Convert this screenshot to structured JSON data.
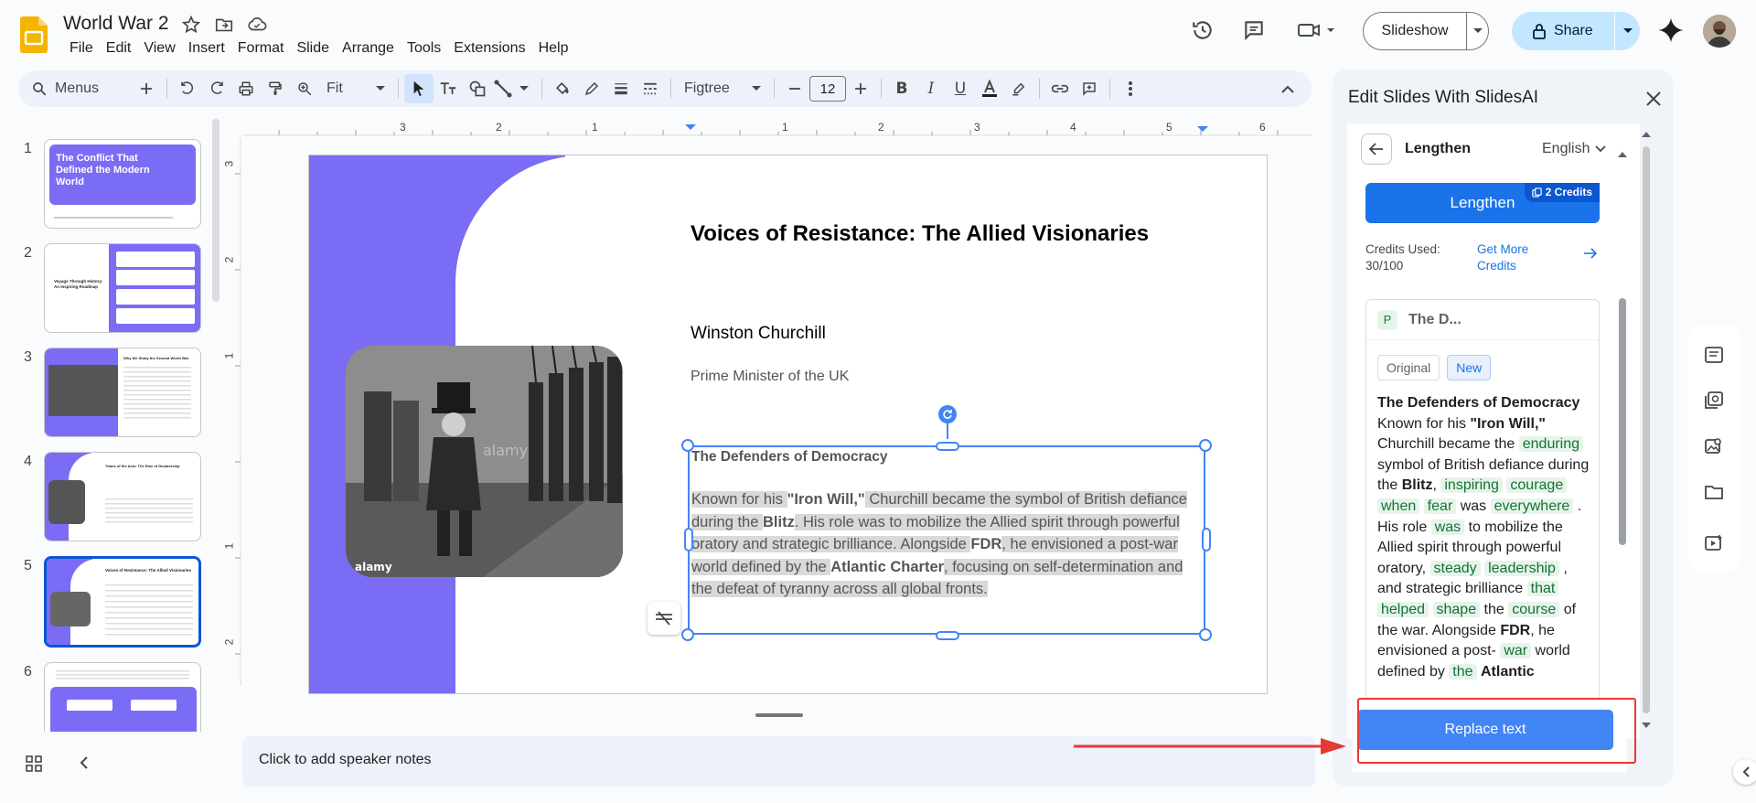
{
  "app": {
    "doc_title": "World War 2",
    "menus": [
      "File",
      "Edit",
      "View",
      "Insert",
      "Format",
      "Slide",
      "Arrange",
      "Tools",
      "Extensions",
      "Help"
    ]
  },
  "header": {
    "slideshow_label": "Slideshow",
    "share_label": "Share"
  },
  "toolbar": {
    "search_label": "Menus",
    "zoom": "Fit",
    "font": "Figtree",
    "font_size": "12"
  },
  "filmstrip": {
    "slides": [
      {
        "num": "1",
        "title": "The Conflict That Defined the Modern World"
      },
      {
        "num": "2",
        "title": "Voyage Through History: An Inspiring Roadmap"
      },
      {
        "num": "3",
        "title": "Why We Study the Second World War"
      },
      {
        "num": "4",
        "title": "Titans of the Axis: The Rise of Dictatorship"
      },
      {
        "num": "5",
        "title": "Voices of Resistance: The Allied Visionaries"
      },
      {
        "num": "6",
        "title": ""
      }
    ]
  },
  "ruler": {
    "h_labels": [
      "3",
      "2",
      "1",
      "1",
      "2",
      "3",
      "4",
      "5",
      "6"
    ],
    "v_labels": [
      "3",
      "2",
      "1",
      "1",
      "2"
    ]
  },
  "slide": {
    "title": "Voices of Resistance: The Allied Visionaries",
    "name": "Winston Churchill",
    "role": "Prime Minister of the UK",
    "text_heading": "The Defenders of Democracy",
    "body_parts": [
      {
        "t": "Known for his ",
        "b": false
      },
      {
        "t": "\"Iron Will,\"",
        "b": true
      },
      {
        "t": " Churchill became the symbol of British defiance during the ",
        "b": false
      },
      {
        "t": "Blitz",
        "b": true
      },
      {
        "t": ". His role was to mobilize the Allied spirit through powerful oratory and strategic brilliance. Alongside ",
        "b": false
      },
      {
        "t": "FDR",
        "b": true
      },
      {
        "t": ", he envisioned a post-war world defined by the ",
        "b": false
      },
      {
        "t": "Atlantic Charter",
        "b": true
      },
      {
        "t": ", focusing on self-determination and the defeat of tyranny across all global fronts.",
        "b": false
      }
    ]
  },
  "speaker_notes": {
    "placeholder": "Click to add speaker notes"
  },
  "panel": {
    "title": "Edit Slides With SlidesAI",
    "mode": "Lengthen",
    "language": "English",
    "action_label": "Lengthen",
    "credits_badge": "2 Credits",
    "credits_used_label": "Credits Used:",
    "credits_used_value": "30/100",
    "get_more": "Get More Credits",
    "result_name": "The D...",
    "result_badge": "P",
    "tab_original": "Original",
    "tab_new": "New",
    "result_parts": [
      {
        "t": "The Defenders of Democracy",
        "k": "b"
      },
      {
        "t": " Known for his ",
        "k": ""
      },
      {
        "t": "\"Iron Will,\"",
        "k": "b"
      },
      {
        "t": " Churchill became the ",
        "k": ""
      },
      {
        "t": "enduring",
        "k": "n"
      },
      {
        "t": " symbol of British defiance during the ",
        "k": ""
      },
      {
        "t": "Blitz",
        "k": "b"
      },
      {
        "t": ", ",
        "k": ""
      },
      {
        "t": "inspiring",
        "k": "n"
      },
      {
        "t": " ",
        "k": ""
      },
      {
        "t": "courage",
        "k": "n"
      },
      {
        "t": " ",
        "k": ""
      },
      {
        "t": "when",
        "k": "n"
      },
      {
        "t": " ",
        "k": ""
      },
      {
        "t": "fear",
        "k": "n"
      },
      {
        "t": " was ",
        "k": ""
      },
      {
        "t": "everywhere",
        "k": "n"
      },
      {
        "t": " . His role ",
        "k": ""
      },
      {
        "t": "was",
        "k": "n"
      },
      {
        "t": " to mobilize the Allied spirit through powerful oratory, ",
        "k": ""
      },
      {
        "t": "steady",
        "k": "n"
      },
      {
        "t": " ",
        "k": ""
      },
      {
        "t": "leadership",
        "k": "n"
      },
      {
        "t": " , and strategic brilliance ",
        "k": ""
      },
      {
        "t": "that",
        "k": "n"
      },
      {
        "t": " ",
        "k": ""
      },
      {
        "t": "helped",
        "k": "n"
      },
      {
        "t": " ",
        "k": ""
      },
      {
        "t": "shape",
        "k": "n"
      },
      {
        "t": " the ",
        "k": ""
      },
      {
        "t": "course",
        "k": "n"
      },
      {
        "t": " of the war. Alongside ",
        "k": ""
      },
      {
        "t": "FDR",
        "k": "b"
      },
      {
        "t": ", he envisioned a post- ",
        "k": ""
      },
      {
        "t": "war",
        "k": "n"
      },
      {
        "t": " world defined by ",
        "k": ""
      },
      {
        "t": "the",
        "k": "n"
      },
      {
        "t": " ",
        "k": ""
      },
      {
        "t": "Atlantic",
        "k": "b"
      }
    ],
    "replace_label": "Replace text"
  },
  "colors": {
    "accent": "#1a73e8",
    "slide_purple": "#7b6cf6",
    "highlight_red": "#e53935"
  }
}
